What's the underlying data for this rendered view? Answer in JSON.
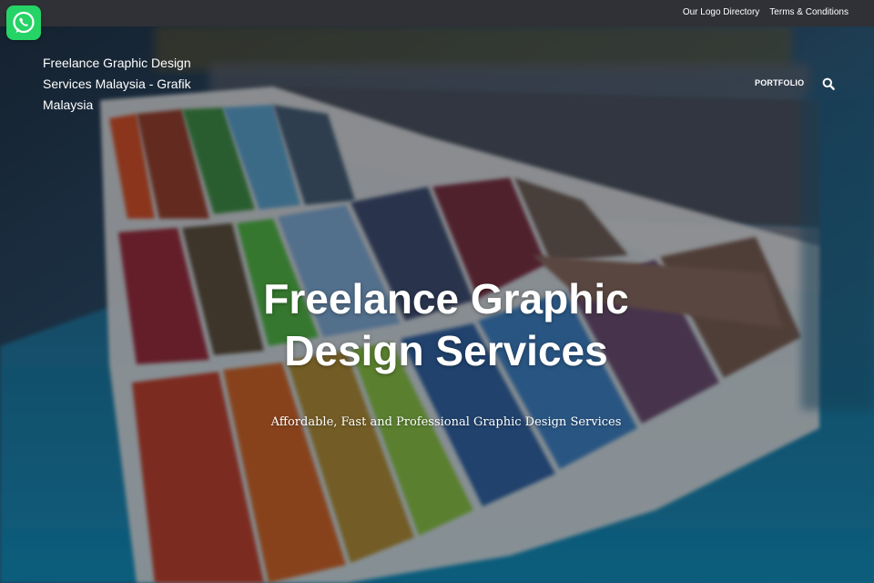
{
  "top_bar": {
    "links": [
      {
        "label": "Our Logo Directory"
      },
      {
        "label": "Terms & Conditions"
      }
    ]
  },
  "whatsapp": {
    "icon": "whatsapp-icon",
    "color": "#25d366"
  },
  "header": {
    "site_title": "Freelance Graphic Design Services Malaysia - Grafik Malaysia",
    "nav": [
      {
        "label": "PORTFOLIO"
      }
    ],
    "search_icon": "search-icon"
  },
  "hero": {
    "heading": "Freelance Graphic Design Services",
    "subheading": "Affordable, Fast and Professional Graphic Design Services"
  },
  "colors": {
    "top_bar": "#2f3136",
    "whatsapp_green": "#25d366",
    "text": "#ffffff"
  }
}
